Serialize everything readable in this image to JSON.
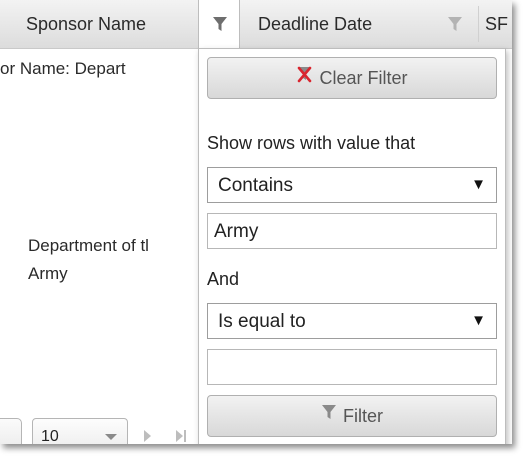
{
  "header": {
    "columns": [
      {
        "label": "Sponsor Name",
        "filter_active": true
      },
      {
        "label": "Deadline Date",
        "filter_active": false
      },
      {
        "label": "SF",
        "filter_active": false
      }
    ]
  },
  "grid": {
    "filter_caption": "or Name: Depart",
    "rows": [
      {
        "sponsor": "Department of tl"
      },
      {
        "sponsor": "Army"
      }
    ]
  },
  "pager": {
    "page_size": "10"
  },
  "filter_menu": {
    "clear_label": "Clear Filter",
    "info": "Show rows with value that",
    "operator1": "Contains",
    "value1": "Army",
    "logic": "And",
    "operator2": "Is equal to",
    "value2": "",
    "filter_label": "Filter",
    "select_arrow": "▼"
  },
  "colors": {
    "header_bg": "#e6e6e6",
    "clear_icon_red": "#d9262f",
    "filter_icon_gray": "#7a7a7a"
  }
}
